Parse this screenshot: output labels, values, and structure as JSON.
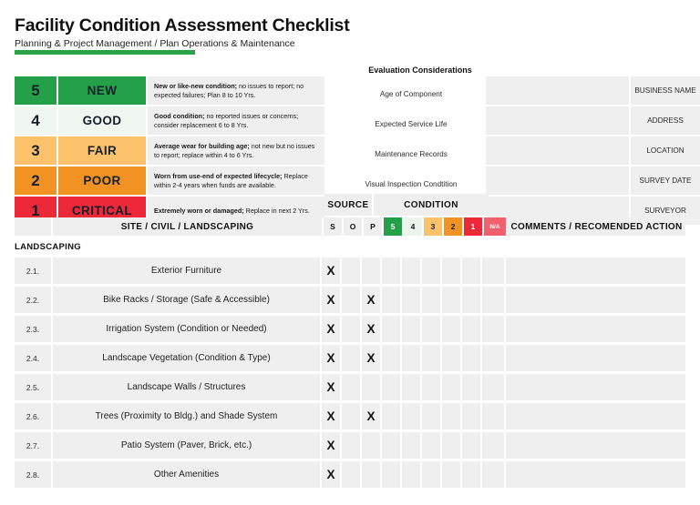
{
  "header": {
    "title": "Facility Condition Assessment Checklist",
    "subtitle": "Planning & Project Management / Plan Operations & Maintenance",
    "accent_color": "#2aa349"
  },
  "legend": {
    "rows": [
      {
        "score": "5",
        "word": "NEW",
        "desc_bold": "New or like-new condition;",
        "desc_rest": " no issues to report; no expected failures; Plan 8 to 10 Yrs.",
        "color": "#24a148",
        "word_color": "#24a148"
      },
      {
        "score": "4",
        "word": "GOOD",
        "desc_bold": "Good condition;",
        "desc_rest": " no reported issues or concerns; consider replacement 6 to 8 Yrs.",
        "color": "#f0f7f1",
        "word_color": "#f0f7f1"
      },
      {
        "score": "3",
        "word": "FAIR",
        "desc_bold": "Average wear for building age;",
        "desc_rest": " not new but no issues to report; replace within 4 to 6 Yrs.",
        "color": "#fcc16b",
        "word_color": "#fcc16b"
      },
      {
        "score": "2",
        "word": "POOR",
        "desc_bold": "Worn from use-end of expected lifecycle;",
        "desc_rest": " Replace within 2-4 years when funds are available.",
        "color": "#f29222",
        "word_color": "#f29222"
      },
      {
        "score": "1",
        "word": "CRITICAL",
        "desc_bold": "Extremely worn or damaged;",
        "desc_rest": " Replace in next 2 Yrs.",
        "color": "#ed2939",
        "word_color": "#ed2939"
      }
    ]
  },
  "evaluation": {
    "title": "Evaluation Considerations",
    "items": [
      "Age of Component",
      "Expected Service Life",
      "Maintenance Records",
      "Visual Inspection Condtition"
    ]
  },
  "info_boxes": [
    {
      "label": "BUSINESS NAME",
      "value": ""
    },
    {
      "label": "ADDRESS",
      "value": ""
    },
    {
      "label": "LOCATION",
      "value": ""
    },
    {
      "label": "SURVEY DATE",
      "value": ""
    },
    {
      "label": "SURVEYOR",
      "value": ""
    }
  ],
  "group_header": {
    "source": "SOURCE",
    "condition": "CONDITION"
  },
  "column_header": {
    "number": "",
    "title": "SITE / CIVIL / LANDSCAPING",
    "source_cols": [
      "S",
      "O",
      "P"
    ],
    "condition_cols": [
      {
        "label": "5",
        "bg": "#24a148",
        "fg": "#ffffff"
      },
      {
        "label": "4",
        "bg": "#eaf5ec",
        "fg": "#15202b"
      },
      {
        "label": "3",
        "bg": "#fcc16b",
        "fg": "#15202b"
      },
      {
        "label": "2",
        "bg": "#f29222",
        "fg": "#15202b"
      },
      {
        "label": "1",
        "bg": "#ed2939",
        "fg": "#ffffff"
      }
    ],
    "na": {
      "label": "N/A",
      "bg": "#f0616d",
      "fg": "#ffffff"
    },
    "comments": "COMMENTS / RECOMENDED ACTION"
  },
  "section_label": "LANDSCAPING",
  "table_rows": [
    {
      "num": "2.1.",
      "title": "Exterior Furniture",
      "S": "X",
      "O": "",
      "P": "",
      "c5": "",
      "c4": "",
      "c3": "",
      "c2": "",
      "c1": "",
      "na": "",
      "comments": ""
    },
    {
      "num": "2.2.",
      "title": "Bike Racks / Storage (Safe & Accessible)",
      "S": "X",
      "O": "",
      "P": "X",
      "c5": "",
      "c4": "",
      "c3": "",
      "c2": "",
      "c1": "",
      "na": "",
      "comments": ""
    },
    {
      "num": "2.3.",
      "title": "Irrigation System (Condition or Needed)",
      "S": "X",
      "O": "",
      "P": "X",
      "c5": "",
      "c4": "",
      "c3": "",
      "c2": "",
      "c1": "",
      "na": "",
      "comments": ""
    },
    {
      "num": "2.4.",
      "title": "Landscape Vegetation (Condition & Type)",
      "S": "X",
      "O": "",
      "P": "X",
      "c5": "",
      "c4": "",
      "c3": "",
      "c2": "",
      "c1": "",
      "na": "",
      "comments": ""
    },
    {
      "num": "2.5.",
      "title": "Landscape Walls / Structures",
      "S": "X",
      "O": "",
      "P": "",
      "c5": "",
      "c4": "",
      "c3": "",
      "c2": "",
      "c1": "",
      "na": "",
      "comments": ""
    },
    {
      "num": "2.6.",
      "title": "Trees (Proximity to Bldg.) and Shade System",
      "S": "X",
      "O": "",
      "P": "X",
      "c5": "",
      "c4": "",
      "c3": "",
      "c2": "",
      "c1": "",
      "na": "",
      "comments": ""
    },
    {
      "num": "2.7.",
      "title": "Patio System (Paver, Brick, etc.)",
      "S": "X",
      "O": "",
      "P": "",
      "c5": "",
      "c4": "",
      "c3": "",
      "c2": "",
      "c1": "",
      "na": "",
      "comments": ""
    },
    {
      "num": "2.8.",
      "title": "Other Amenities",
      "S": "X",
      "O": "",
      "P": "",
      "c5": "",
      "c4": "",
      "c3": "",
      "c2": "",
      "c1": "",
      "na": "",
      "comments": ""
    }
  ]
}
